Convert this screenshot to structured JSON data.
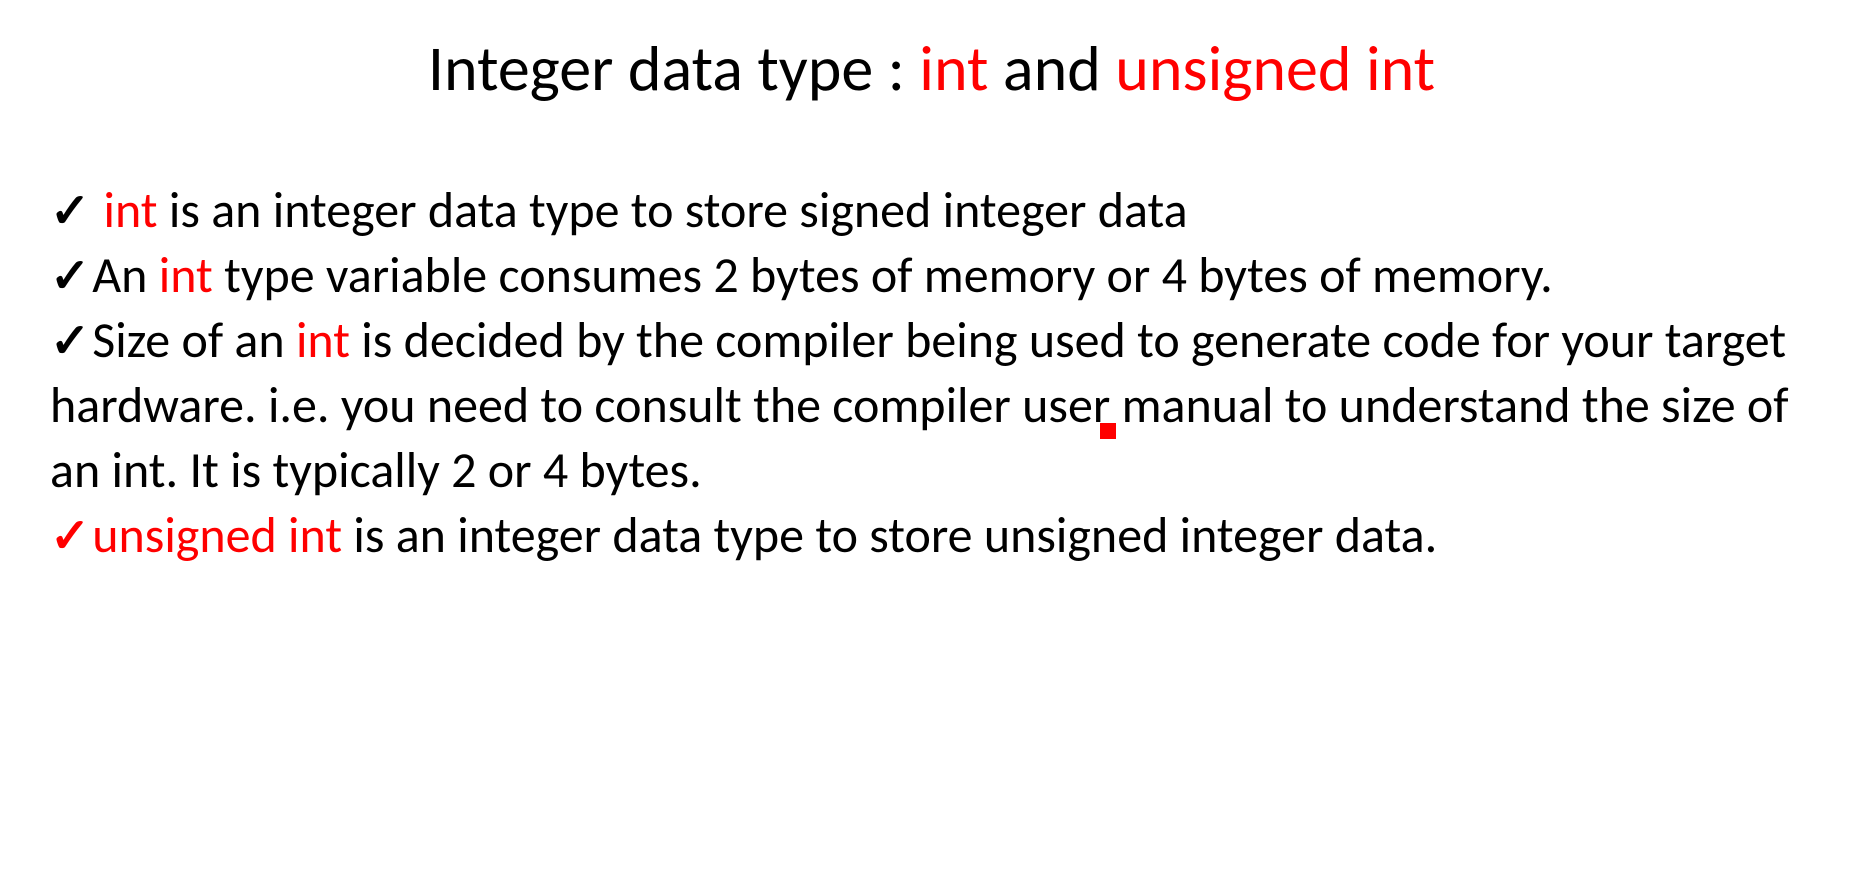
{
  "title": {
    "part1": "Integer data type : ",
    "part2_red": "int",
    "part3": " and ",
    "part4_red": "unsigned int"
  },
  "bullets": {
    "b1": {
      "pre": " ",
      "red": "int",
      "post": " is an integer data type to store signed integer data"
    },
    "b2": {
      "pre": "An ",
      "red": "int",
      "post": " type variable consumes 2 bytes of memory or 4 bytes of memory."
    },
    "b3": {
      "pre": "Size of an ",
      "red": "int",
      "post": " is decided by the compiler being used to generate code for your target hardware. i.e. you need to consult the compiler user manual to understand the size of an int. It is typically 2 or 4 bytes."
    },
    "b4": {
      "red": "unsigned int",
      "post": " is an integer data type to store unsigned integer data."
    }
  },
  "checkmark": "✓"
}
